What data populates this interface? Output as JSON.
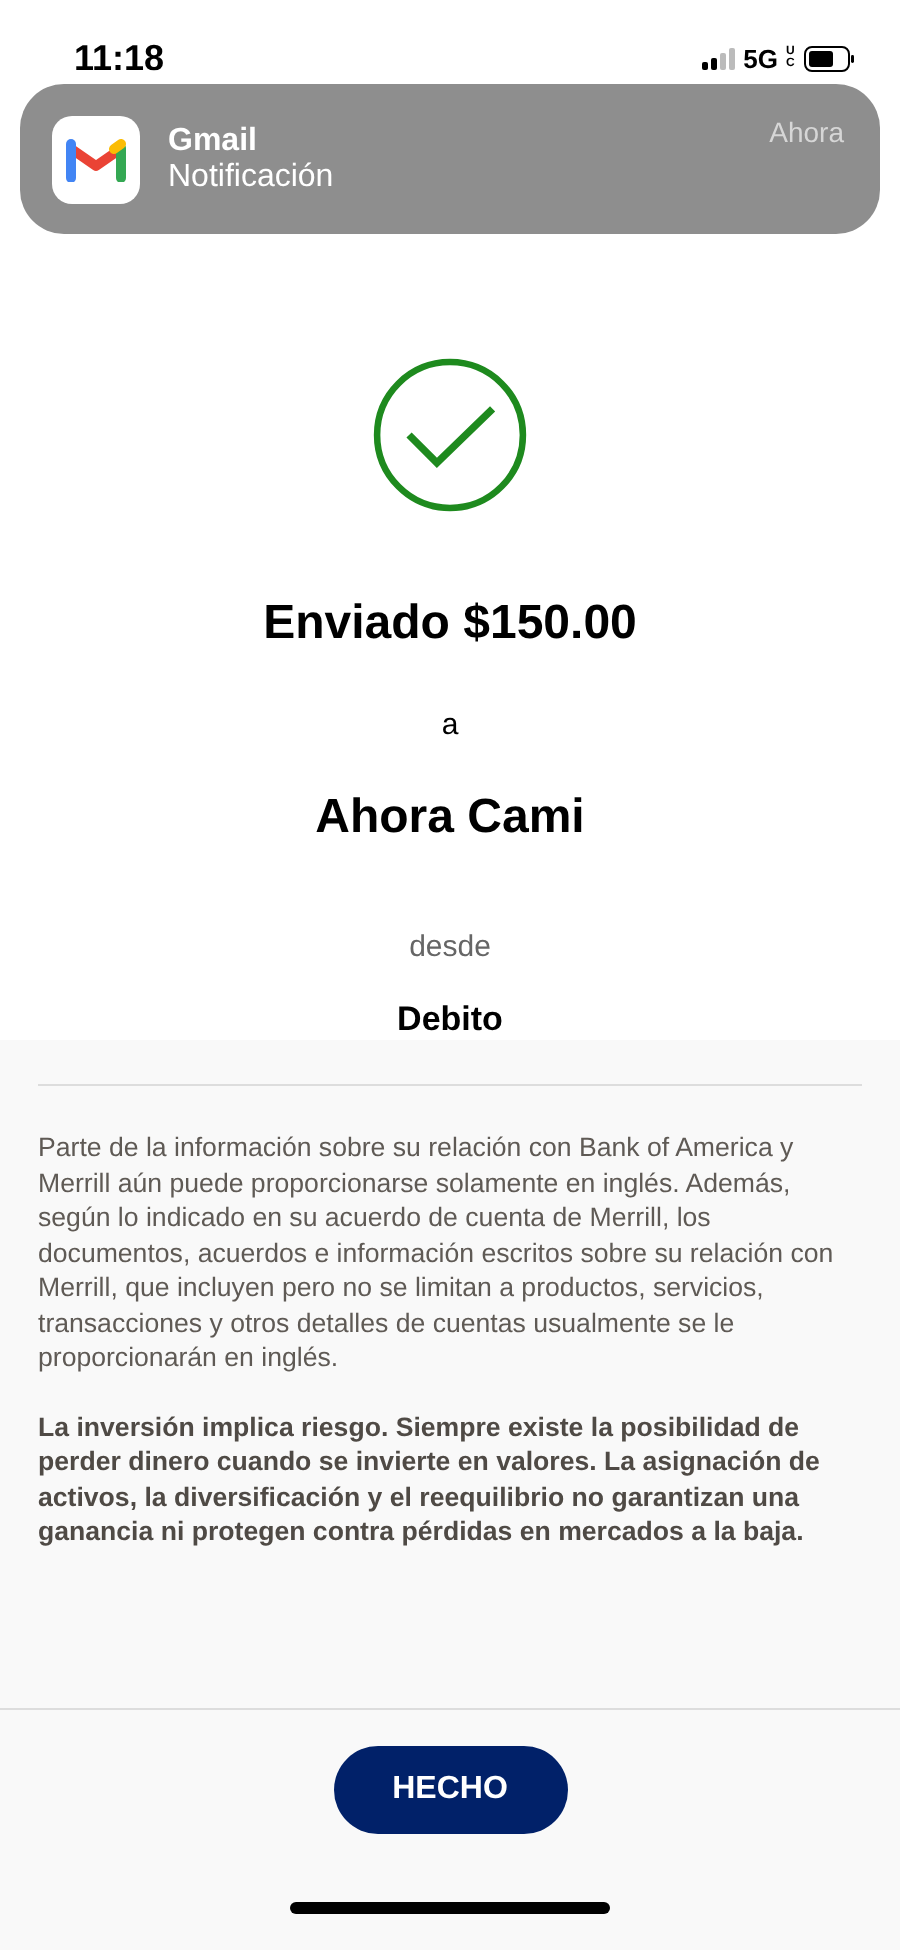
{
  "status_bar": {
    "time": "11:18",
    "network": "5G",
    "network_suffix": "UC"
  },
  "notification": {
    "app": "Gmail",
    "message": "Notificación",
    "time": "Ahora"
  },
  "confirmation": {
    "amount_line": "Enviado $150.00",
    "connector": "a",
    "recipient": "Ahora Cami",
    "from_label": "desde",
    "account": "Debito"
  },
  "disclosures": [
    {
      "kind": "plain",
      "text": "Parte de la información sobre su relación con Bank of America y Merrill aún puede proporcionarse solamente en inglés. Además, según lo indicado en su acuerdo de cuenta de Merrill, los documentos, acuerdos e información escritos sobre su relación con Merrill, que incluyen pero no se limitan a productos, servicios, transacciones y otros detalles de cuentas usualmente se le proporcionarán en inglés."
    },
    {
      "kind": "bold",
      "text": "La inversión implica riesgo. Siempre existe la posibilidad de perder dinero cuando se invierte en valores. La asignación de activos, la diversificación y el reequilibrio no garantizan una ganancia ni protegen contra pérdidas en mercados a la baja."
    }
  ],
  "done_button": "HECHO"
}
